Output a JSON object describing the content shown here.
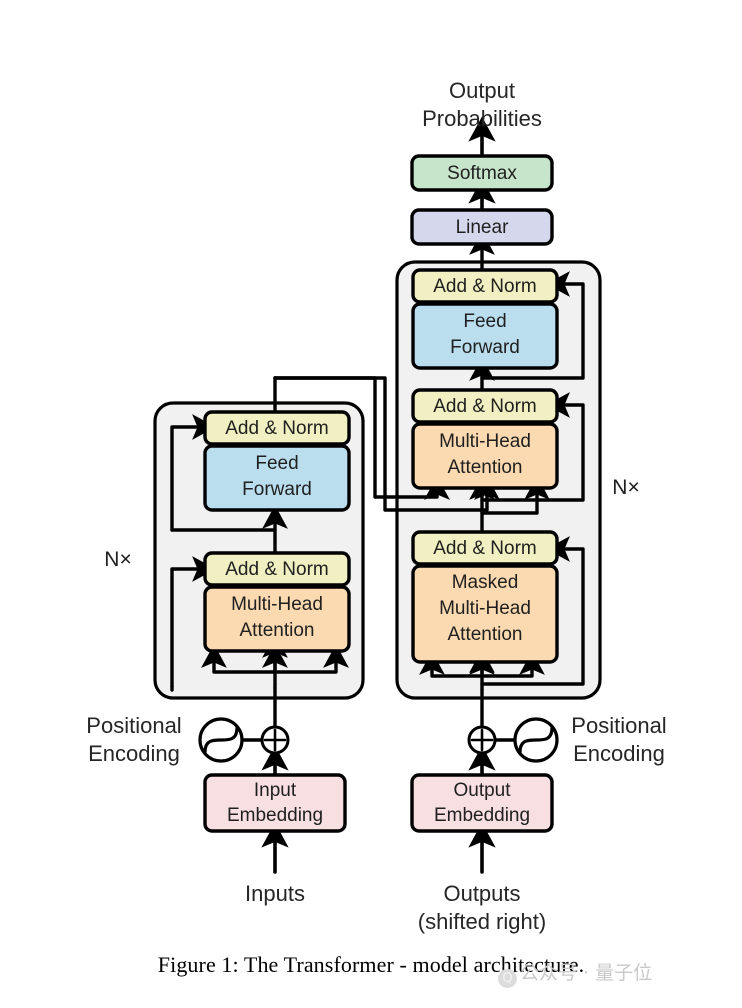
{
  "figure": {
    "caption": "Figure 1: The Transformer - model architecture.",
    "watermark": {
      "logo_glyph": "Q",
      "text": "公众号 · 量子位"
    }
  },
  "colors": {
    "add_norm": "#f0f0c3",
    "feed_forward": "#badeee",
    "attention": "#fbd9b1",
    "embedding": "#f8dfe2",
    "softmax": "#c7e5ca",
    "linear": "#d5d8ed",
    "stack_bg": "#f1f1f1",
    "stroke": "#000000",
    "text": "#1f1f1f"
  },
  "labels": {
    "output_probabilities_line1": "Output",
    "output_probabilities_line2": "Probabilities",
    "inputs": "Inputs",
    "outputs_line1": "Outputs",
    "outputs_line2": "(shifted right)",
    "positional_encoding_line1": "Positional",
    "positional_encoding_line2": "Encoding",
    "encoder_repeat": "N×",
    "decoder_repeat": "N×"
  },
  "blocks": {
    "softmax": {
      "label": "Softmax"
    },
    "linear": {
      "label": "Linear"
    },
    "encoder_add_norm_top": {
      "label": "Add & Norm"
    },
    "encoder_feed_forward": {
      "line1": "Feed",
      "line2": "Forward"
    },
    "encoder_add_norm_bottom": {
      "label": "Add & Norm"
    },
    "encoder_multi_head_attention": {
      "line1": "Multi-Head",
      "line2": "Attention"
    },
    "decoder_add_norm_top": {
      "label": "Add & Norm"
    },
    "decoder_feed_forward": {
      "line1": "Feed",
      "line2": "Forward"
    },
    "decoder_add_norm_middle": {
      "label": "Add & Norm"
    },
    "decoder_multi_head_attention": {
      "line1": "Multi-Head",
      "line2": "Attention"
    },
    "decoder_add_norm_bottom": {
      "label": "Add & Norm"
    },
    "decoder_masked_multi_head_attention": {
      "line1": "Masked",
      "line2": "Multi-Head",
      "line3": "Attention"
    },
    "input_embedding": {
      "line1": "Input",
      "line2": "Embedding"
    },
    "output_embedding": {
      "line1": "Output",
      "line2": "Embedding"
    }
  },
  "icons": {
    "positional_encoding_sine": "sine-wave-circle-icon",
    "add_operator": "circled-plus-icon"
  }
}
